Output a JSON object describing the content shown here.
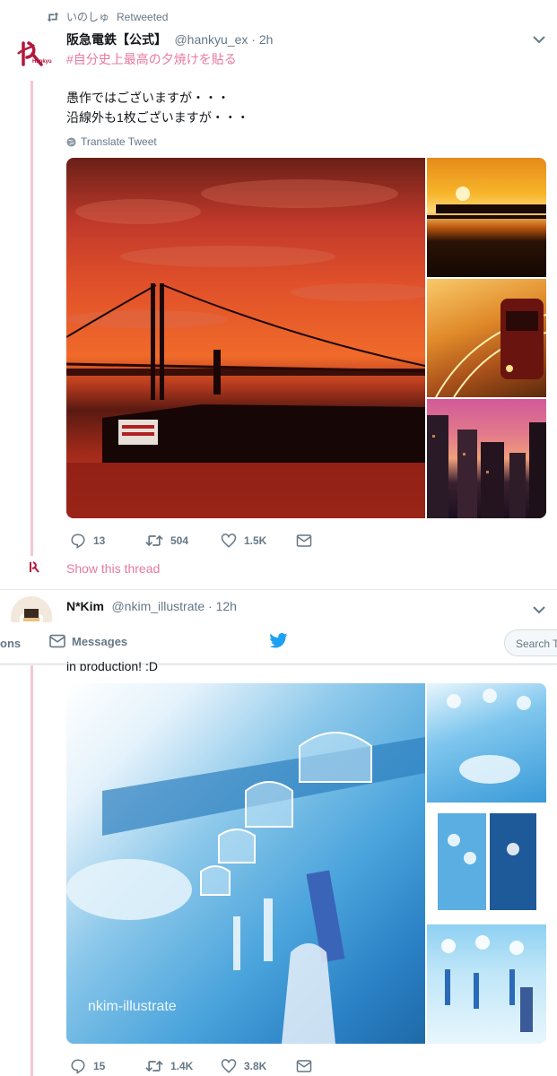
{
  "tweet1": {
    "retweet_by": "いのしゅ",
    "retweet_label": "Retweeted",
    "name": "阪急電鉄【公式】",
    "handle": "@hankyu_ex · 2h",
    "hashtag": "#自分史上最高の夕焼けを貼る",
    "line1": "愚作ではございますが・・・",
    "line2": "沿線外も1枚ございますが・・・",
    "translate": "Translate Tweet",
    "avatar_text": "Hankyu",
    "replies": "13",
    "retweets": "504",
    "likes": "1.5K",
    "show_thread": "Show this thread"
  },
  "tweet2": {
    "name": "N*Kim",
    "handle": "@nkim_illustrate · 12h",
    "text_partial": "in production! :D",
    "watermark": "nkim-illustrate",
    "replies": "15",
    "retweets": "1.4K",
    "likes": "3.8K"
  },
  "nav": {
    "partial_left": "ons",
    "messages": "Messages",
    "search_placeholder": "Search Tw"
  },
  "colors": {
    "accent": "#1da1f2",
    "hankyu_pink": "#e8799d",
    "hankyu_red": "#b5173b"
  }
}
